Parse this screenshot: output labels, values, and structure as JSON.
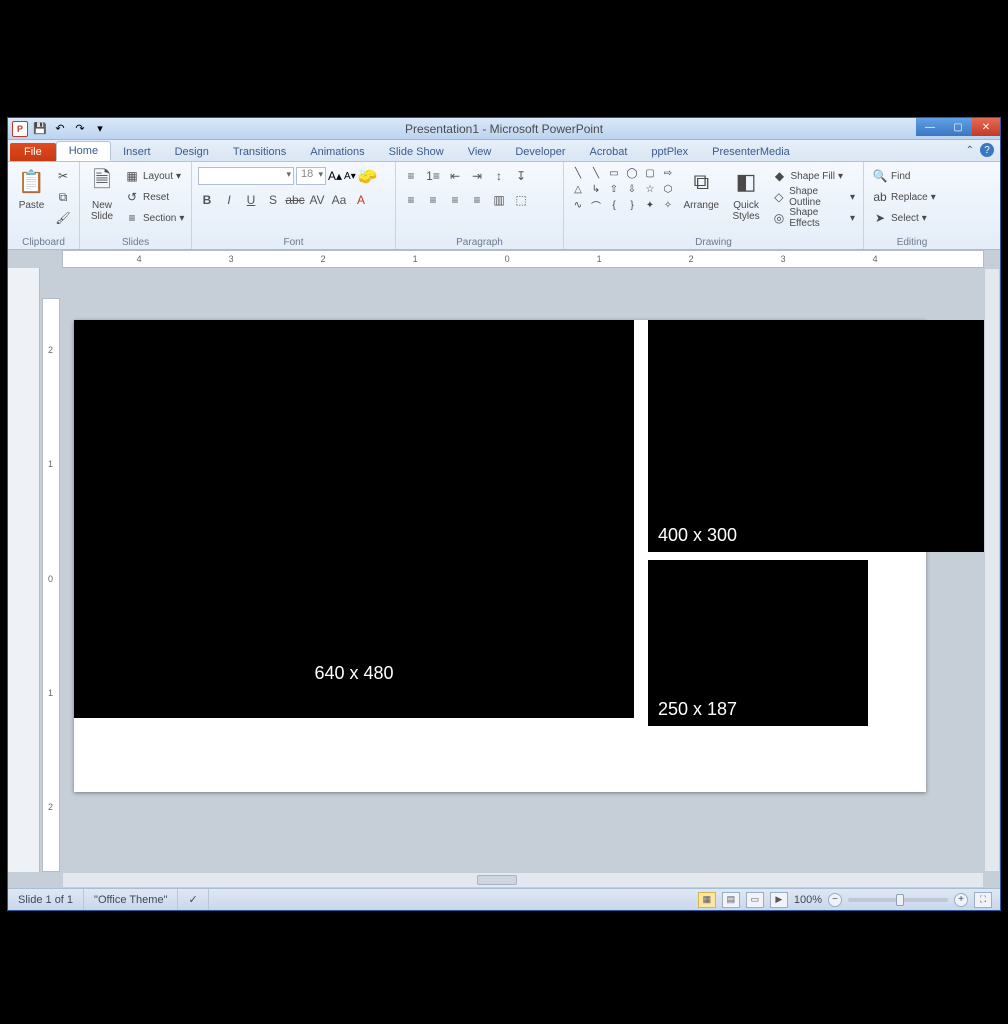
{
  "window": {
    "title": "Presentation1 - Microsoft PowerPoint"
  },
  "qat": {
    "save": "💾",
    "undo": "↶",
    "redo": "↷",
    "more": "▾"
  },
  "tabs": {
    "file": "File",
    "items": [
      "Home",
      "Insert",
      "Design",
      "Transitions",
      "Animations",
      "Slide Show",
      "View",
      "Developer",
      "Acrobat",
      "pptPlex",
      "PresenterMedia"
    ],
    "active": "Home"
  },
  "ribbon": {
    "clipboard": {
      "label": "Clipboard",
      "paste": "Paste",
      "cut": "Cut",
      "copy": "Copy",
      "painter": "Format Painter"
    },
    "slides": {
      "label": "Slides",
      "new_slide": "New\nSlide",
      "layout": "Layout",
      "reset": "Reset",
      "section": "Section"
    },
    "font": {
      "label": "Font",
      "face": "",
      "size": "18",
      "buttons": [
        "B",
        "I",
        "U",
        "S",
        "abc",
        "AV",
        "Aa",
        "A"
      ]
    },
    "paragraph": {
      "label": "Paragraph"
    },
    "drawing": {
      "label": "Drawing",
      "arrange": "Arrange",
      "quick": "Quick\nStyles",
      "fill": "Shape Fill",
      "outline": "Shape Outline",
      "effects": "Shape Effects"
    },
    "editing": {
      "label": "Editing",
      "find": "Find",
      "replace": "Replace",
      "select": "Select"
    }
  },
  "ruler": {
    "h": [
      "4",
      "3",
      "2",
      "1",
      "0",
      "1",
      "2",
      "3",
      "4"
    ],
    "v": [
      "2",
      "1",
      "0",
      "1",
      "2"
    ]
  },
  "slide": {
    "box_big": "640 x 480",
    "box_med": "400 x 300",
    "box_small": "250 x 187"
  },
  "status": {
    "slide": "Slide 1 of 1",
    "theme": "\"Office Theme\"",
    "zoom": "100%"
  }
}
